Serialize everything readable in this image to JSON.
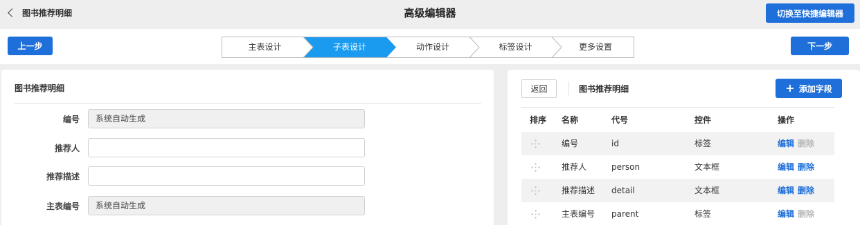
{
  "header": {
    "back_label": "图书推荐明细",
    "title": "高级编辑器",
    "switch_label": "切换至快捷编辑器"
  },
  "stepbar": {
    "prev_label": "上一步",
    "next_label": "下一步",
    "steps": [
      {
        "label": "主表设计",
        "active": false
      },
      {
        "label": "子表设计",
        "active": true
      },
      {
        "label": "动作设计",
        "active": false
      },
      {
        "label": "标签设计",
        "active": false
      },
      {
        "label": "更多设置",
        "active": false
      }
    ]
  },
  "form": {
    "title": "图书推荐明细",
    "fields": [
      {
        "label": "编号",
        "value": "系统自动生成",
        "readonly": true
      },
      {
        "label": "推荐人",
        "value": "",
        "readonly": false
      },
      {
        "label": "推荐描述",
        "value": "",
        "readonly": false
      },
      {
        "label": "主表编号",
        "value": "系统自动生成",
        "readonly": true
      }
    ]
  },
  "fields_panel": {
    "return_label": "返回",
    "title": "图书推荐明细",
    "add_label": "添加字段",
    "columns": [
      "排序",
      "名称",
      "代号",
      "控件",
      "操作"
    ],
    "edit_label": "编辑",
    "delete_label": "删除",
    "rows": [
      {
        "name": "编号",
        "code": "id",
        "control": "标签",
        "deletable": false
      },
      {
        "name": "推荐人",
        "code": "person",
        "control": "文本框",
        "deletable": true
      },
      {
        "name": "推荐描述",
        "code": "detail",
        "control": "文本框",
        "deletable": true
      },
      {
        "name": "主表编号",
        "code": "parent",
        "control": "标签",
        "deletable": false
      }
    ]
  },
  "colors": {
    "accent": "#1e6fd9",
    "active_step": "#1a9bf0",
    "disabled_text": "#b8b8b8"
  }
}
